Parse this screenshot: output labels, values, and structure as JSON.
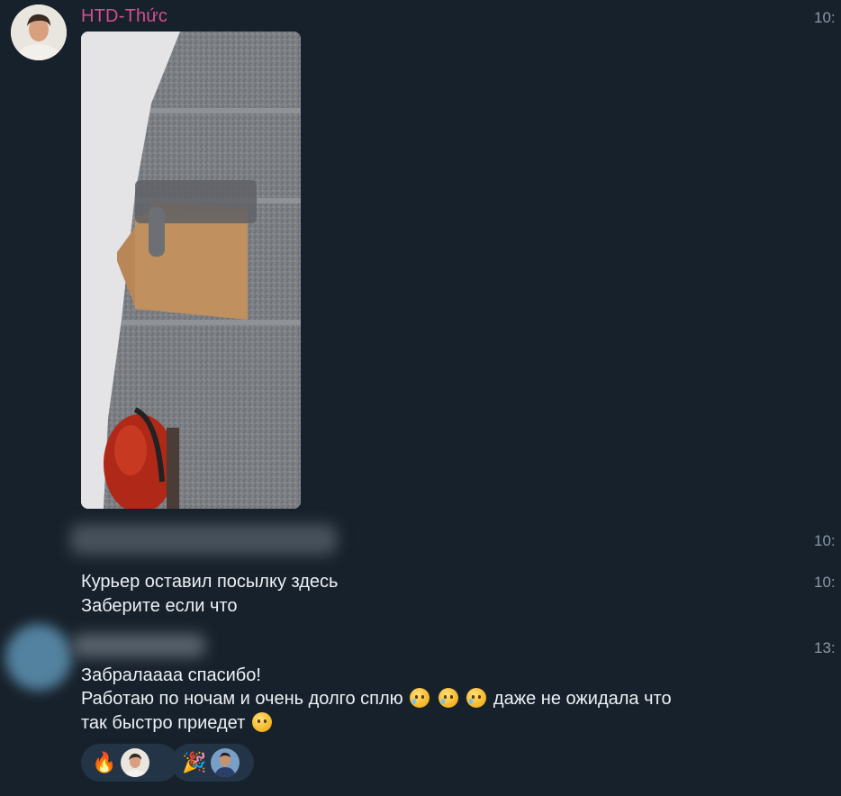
{
  "messages": [
    {
      "sender": "HTD-Thức",
      "time": "10:",
      "photo_alt": "package at stairwell"
    },
    {
      "time": "10:"
    },
    {
      "time": "10:",
      "lines": [
        "Курьер оставил посылку здесь",
        "Заберите если что"
      ]
    },
    {
      "time": "13:",
      "line1": "Забралаааа спасибо!",
      "line2_before": "Работаю по ночам и очень долго сплю ",
      "line2_after": " даже не ожидала что",
      "line3": "так быстро приедет "
    }
  ],
  "reactions": [
    {
      "emoji": "🔥",
      "icon": "fire-icon"
    },
    {
      "emoji": "🎉",
      "icon": "party-popper-icon"
    }
  ],
  "colors": {
    "background": "#17212b",
    "sender_name": "#d34f8f",
    "reaction_bg": "#243447",
    "time": "#8a98a6"
  }
}
